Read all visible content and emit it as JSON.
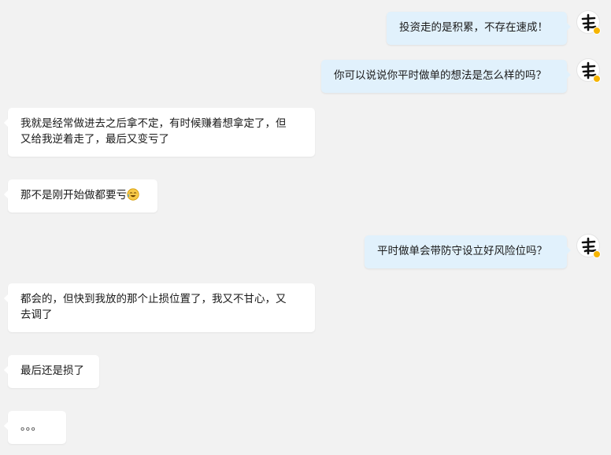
{
  "colors": {
    "background": "#f2f2f2",
    "outgoing_bubble": "#e1f1fc",
    "incoming_bubble": "#ffffff",
    "verified_badge": "#f5b400"
  },
  "avatar": {
    "icon": "calligraphy-avatar-icon",
    "badge_icon": "verified-badge-icon"
  },
  "messages": [
    {
      "side": "right",
      "text": "投资走的是积累，不存在速成！"
    },
    {
      "side": "right",
      "text": "你可以说说你平时做单的想法是怎么样的吗？"
    },
    {
      "side": "left",
      "line1": "我就是经常做进去之后拿不定，有时候赚着想拿定了，但",
      "line2": "又给我逆着走了，最后又变亏了"
    },
    {
      "side": "left",
      "text": "那不是刚开始做都要亏",
      "emoji": "laughing-emoji-icon"
    },
    {
      "side": "right",
      "text": "平时做单会带防守设立好风险位吗？"
    },
    {
      "side": "left",
      "line1": "都会的，但快到我放的那个止损位置了，我又不甘心，又",
      "line2": "去调了"
    },
    {
      "side": "left",
      "text": "最后还是损了"
    },
    {
      "side": "left",
      "text": "。。。"
    }
  ]
}
